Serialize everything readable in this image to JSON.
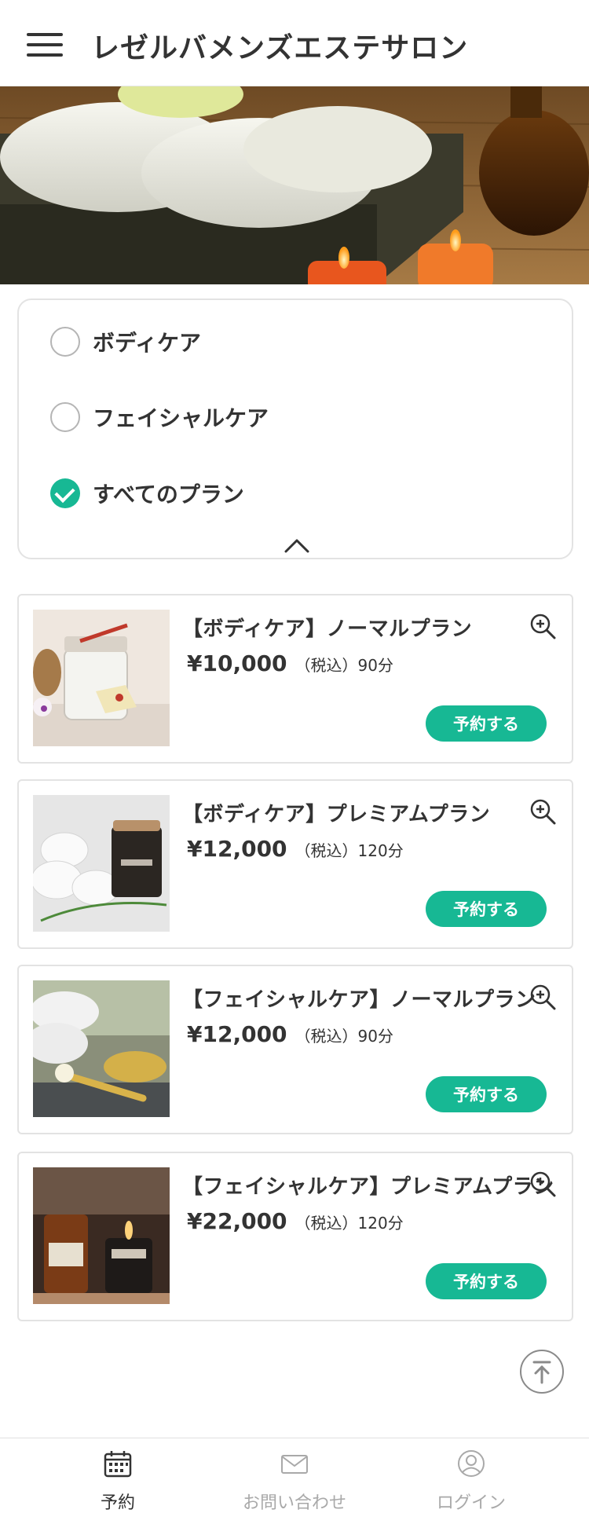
{
  "header": {
    "title": "レゼルバメンズエステサロン",
    "menu_icon": "hamburger-menu-icon"
  },
  "hero": {
    "image": "spa-towels-candles-photo"
  },
  "filter": {
    "options": [
      {
        "label": "ボディケア",
        "checked": false
      },
      {
        "label": "フェイシャルケア",
        "checked": false
      },
      {
        "label": "すべてのプラン",
        "checked": true
      }
    ],
    "collapse_icon": "chevron-up-icon"
  },
  "plans": [
    {
      "name": "【ボディケア】ノーマルプラン",
      "price": "¥10,000",
      "tax": "（税込）",
      "duration": "90分",
      "button": "予約する",
      "image": "bath-salt-jar-photo"
    },
    {
      "name": "【ボディケア】プレミアムプラン",
      "price": "¥12,000",
      "tax": "（税込）",
      "duration": "120分",
      "button": "予約する",
      "image": "white-towels-candle-photo"
    },
    {
      "name": "【フェイシャルケア】ノーマルプラン",
      "price": "¥12,000",
      "tax": "（税込）",
      "duration": "90分",
      "button": "予約する",
      "image": "towels-oil-roller-photo"
    },
    {
      "name": "【フェイシャルケア】プレミアムプラン",
      "price": "¥22,000",
      "tax": "（税込）",
      "duration": "120分",
      "button": "予約する",
      "image": "aroma-bottles-candle-photo"
    }
  ],
  "nav": {
    "items": [
      {
        "label": "予約",
        "icon": "calendar-icon",
        "active": true
      },
      {
        "label": "お問い合わせ",
        "icon": "mail-icon",
        "active": false
      },
      {
        "label": "ログイン",
        "icon": "user-icon",
        "active": false
      }
    ]
  },
  "colors": {
    "accent": "#17b894",
    "text": "#333333",
    "inactive": "#a9a9a9",
    "border": "#e3e3e3"
  }
}
